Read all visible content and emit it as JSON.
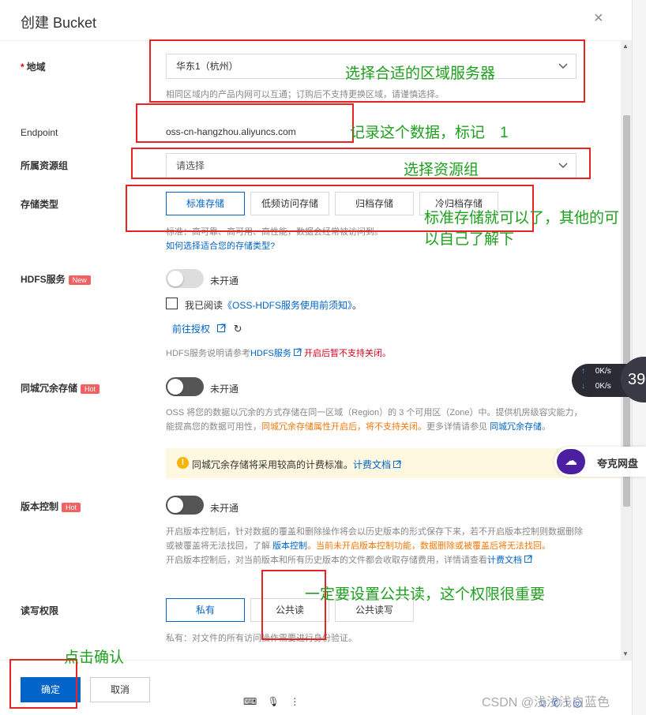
{
  "dialog": {
    "title": "创建 Bucket",
    "close_label": "×"
  },
  "region": {
    "label": "地域",
    "required_mark": "*",
    "value": "华东1（杭州）",
    "hint": "相同区域内的产品内网可以互通；订购后不支持更换区域，请谨慎选择。"
  },
  "endpoint": {
    "label": "Endpoint",
    "value": "oss-cn-hangzhou.aliyuncs.com"
  },
  "resource_group": {
    "label": "所属资源组",
    "placeholder": "请选择"
  },
  "storage_class": {
    "label": "存储类型",
    "options": [
      "标准存储",
      "低频访问存储",
      "归档存储",
      "冷归档存储"
    ],
    "selected": "标准存储",
    "hint": "标准：高可靠、高可用、高性能，数据会经常被访问到。",
    "help_link": "如何选择适合您的存储类型?"
  },
  "hdfs": {
    "label": "HDFS服务",
    "badge": "New",
    "toggle_text": "未开通",
    "agree_prefix": "我已阅读",
    "agree_link": "《OSS-HDFS服务使用前须知》",
    "agree_suffix": "。",
    "authorize_link": "前往授权",
    "note_prefix": "HDFS服务说明请参考",
    "note_link": "HDFS服务",
    "note_warning": "开启后暂不支持关闭。"
  },
  "zone_redundancy": {
    "label": "同城冗余存储",
    "badge": "Hot",
    "toggle_text": "未开通",
    "desc_1": "OSS 将您的数据以冗余的方式存储在同一区域（Region）的 3 个可用区（Zone）中。提供机房级容灾能力，能提高您的数据可用性，",
    "desc_orange": "同城冗余存储属性开启后，将不支持关闭。",
    "desc_2": "更多详情请参见",
    "desc_link": "同城冗余存储",
    "desc_end": "。",
    "notice_text": "同城冗余存储将采用较高的计费标准。",
    "notice_link": "计费文档"
  },
  "versioning": {
    "label": "版本控制",
    "badge": "Hot",
    "toggle_text": "未开通",
    "desc_1": "开启版本控制后，针对数据的覆盖和删除操作将会以历史版本的形式保存下来，若不开启版本控制则数据删除或被覆盖将无法找回，了解",
    "desc_link": "版本控制",
    "desc_orange": "。当前未开启版本控制功能，数据删除或被覆盖后将无法找回。",
    "desc_3": "开启版本控制后，对当前版本和所有历史版本的文件都会收取存储费用，详情请查看",
    "desc_3_link": "计费文档"
  },
  "acl": {
    "label": "读写权限",
    "options": [
      "私有",
      "公共读",
      "公共读写"
    ],
    "selected": "私有",
    "hint": "私有：对文件的所有访问操作需要进行身份验证。"
  },
  "footer": {
    "confirm": "确定",
    "cancel": "取消"
  },
  "annotations": {
    "region": "选择合适的区域服务器",
    "endpoint": "记录这个数据，标记　1",
    "resource_group": "选择资源组",
    "storage_line1": "标准存储就可以了，其他的可",
    "storage_line2": "以自己了解下",
    "acl": "一定要设置公共读，这个权限很重要",
    "confirm": "点击确认"
  },
  "overlays": {
    "speed_up": "0K/s",
    "speed_down": "0K/s",
    "circle_number": "39",
    "quark_name": "夸克网盘",
    "watermark": "CSDN @浅浅浅白蓝色"
  },
  "colors": {
    "primary": "#0064c8",
    "annotation_green": "#1ea01e",
    "annotation_red": "#e82323",
    "badge_red": "#f06262",
    "warning_orange": "#f0780a"
  }
}
